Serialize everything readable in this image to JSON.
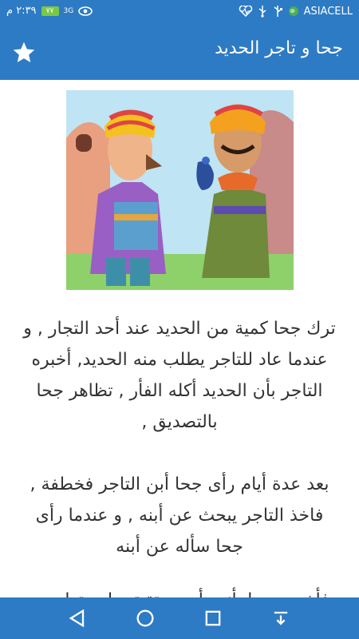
{
  "status_bar": {
    "time": "٢:٣٩ م",
    "battery": "٧٧",
    "network": "3G",
    "carrier": "ASIACELL"
  },
  "app_bar": {
    "title": "جحا و تاجر الحديد",
    "star_icon": "star-icon"
  },
  "content": {
    "paragraphs": [
      "ترك جحا كمية من الحديد عند أحد التجار , و عندما عاد للتاجر يطلب منه الحديد, أخبره التاجر بأن الحديد أكله الفأر , تظاهر جحا بالتصديق ,",
      "بعد عدة أيام رأى جحا أبن التاجر فخطفة , فاخذ التاجر يبحث عن أبنه , و عندما رأى جحا سأله عن أبنه",
      "فأخبره جحا بأنه رأى حوتة تحمله وتطير به"
    ]
  },
  "nav_bar": {
    "back_icon": "back-icon",
    "home_icon": "home-icon",
    "recents_icon": "recents-icon",
    "notifications_icon": "pull-down-icon"
  }
}
